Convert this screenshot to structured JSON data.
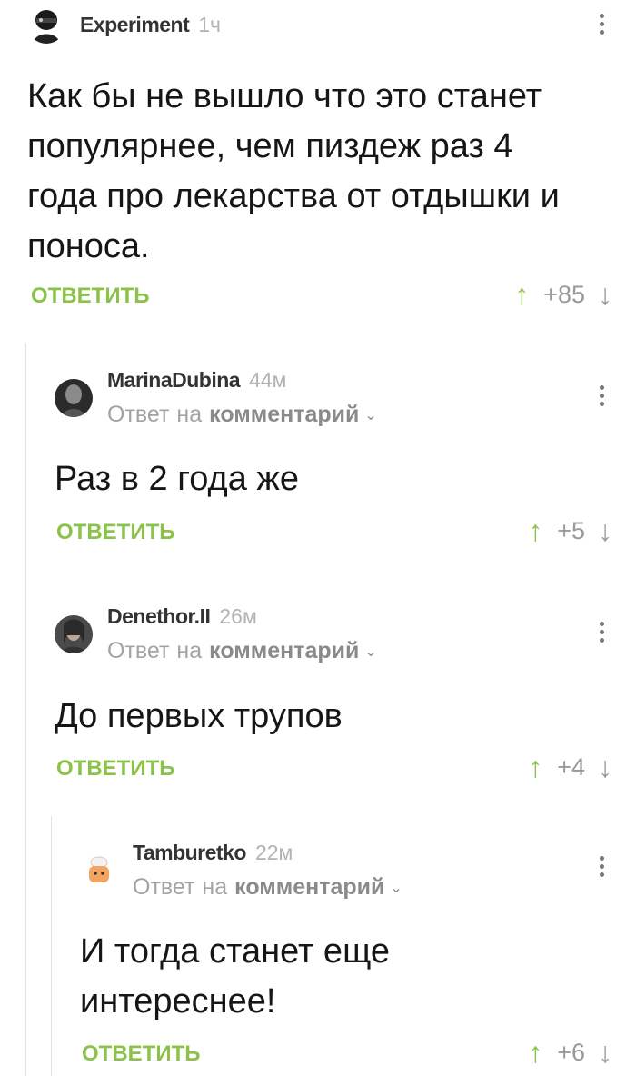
{
  "comments": [
    {
      "username": "Experiment",
      "time": "1ч",
      "body_lines": [
        "Как бы не вышло что это станет",
        "популярнее, чем пиздеж раз 4",
        "года про лекарства от отдышки и",
        "поноса."
      ],
      "reply_label": "ОТВЕТИТЬ",
      "rating": "+85"
    },
    {
      "username": "MarinaDubina",
      "time": "44м",
      "reply_prefix": "Ответ",
      "reply_na": "на",
      "reply_link": "комментарий",
      "body_lines": [
        "Раз в 2 года же"
      ],
      "reply_label": "ОТВЕТИТЬ",
      "rating": "+5"
    },
    {
      "username": "Denethor.II",
      "time": "26м",
      "reply_prefix": "Ответ",
      "reply_na": "на",
      "reply_link": "комментарий",
      "body_lines": [
        "До первых трупов"
      ],
      "reply_label": "ОТВЕТИТЬ",
      "rating": "+4"
    },
    {
      "username": "Tamburetko",
      "time": "22м",
      "reply_prefix": "Ответ",
      "reply_na": "на",
      "reply_link": "комментарий",
      "body_lines": [
        "И тогда станет еще",
        "интереснее!"
      ],
      "reply_label": "ОТВЕТИТЬ",
      "rating": "+6"
    }
  ],
  "icons": {
    "upvote": "arrow-up-icon",
    "downvote": "arrow-down-icon",
    "more": "more-vertical-icon",
    "chevron": "chevron-down-icon"
  },
  "colors": {
    "accent_green": "#8bc34a",
    "muted_text": "#a3a3a3",
    "thread_line": "#e2e2e2"
  },
  "glyphs": {
    "up": "↑",
    "down": "↓",
    "chevron": "⌄"
  }
}
